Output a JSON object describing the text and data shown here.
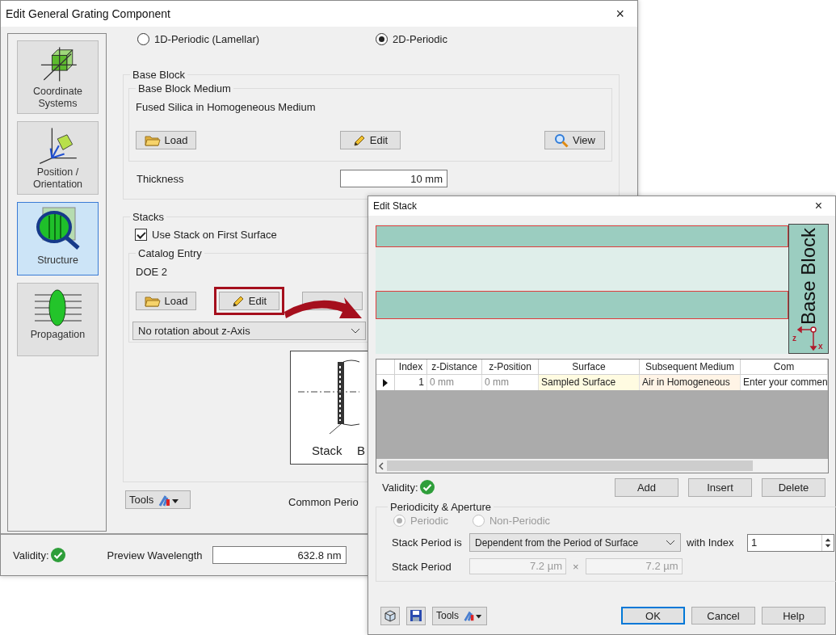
{
  "main_window": {
    "title": "Edit General Grating Component",
    "close": "×",
    "sidebar": [
      {
        "label": "Coordinate Systems",
        "kind": "coordinates",
        "selected": false
      },
      {
        "label": "Position / Orientation",
        "kind": "position",
        "selected": false
      },
      {
        "label": "Structure",
        "kind": "structure",
        "selected": true
      },
      {
        "label": "Propagation",
        "kind": "propagation",
        "selected": false
      }
    ],
    "periodicity": [
      {
        "label": "1D-Periodic (Lamellar)",
        "selected": false
      },
      {
        "label": "2D-Periodic",
        "selected": true
      }
    ],
    "base_block": {
      "title": "Base Block",
      "medium_title": "Base Block Medium",
      "medium": "Fused Silica in Homogeneous Medium",
      "buttons": [
        {
          "label": "Load",
          "kind": "load"
        },
        {
          "label": "Edit",
          "kind": "edit"
        },
        {
          "label": "View",
          "kind": "view"
        }
      ],
      "thickness_label": "Thickness",
      "thickness": "10 mm"
    },
    "stacks": {
      "title": "Stacks",
      "use_stack": {
        "label": "Use Stack on First Surface",
        "checked": true
      },
      "catalog_title": "Catalog Entry",
      "catalog": "DOE 2",
      "buttons": [
        {
          "label": "Load",
          "kind": "load",
          "highlighted": false
        },
        {
          "label": "Edit",
          "kind": "edit",
          "highlighted": true
        },
        {
          "kind": "covered",
          "highlighted": false
        }
      ],
      "rotation": "No rotation about z-Axis"
    },
    "diagram_labels": [
      "Stack",
      "B"
    ],
    "tools": "Tools",
    "common_period": "Common Perio",
    "footer": {
      "validity": "Validity:",
      "valid": true,
      "wavelength_label": "Preview Wavelength",
      "wavelength": "632.8 nm"
    }
  },
  "stack_window": {
    "title": "Edit Stack",
    "close": "×",
    "base_block_label": "Base Block",
    "axes": [
      "z",
      "x"
    ],
    "table": {
      "columns": [
        "Index",
        "z-Distance",
        "z-Position",
        "Surface",
        "Subsequent Medium",
        "Com"
      ],
      "rows": [
        {
          "current": true,
          "cells": [
            "1",
            "0 mm",
            "0 mm",
            "Sampled Surface",
            "Air in Homogeneous",
            "Enter your commen"
          ]
        }
      ]
    },
    "validity": "Validity:",
    "valid": true,
    "buttons": [
      "Add",
      "Insert",
      "Delete"
    ],
    "group": {
      "title": "Periodicity & Aperture",
      "radios": [
        {
          "label": "Periodic",
          "selected": true,
          "disabled": true
        },
        {
          "label": "Non-Periodic",
          "selected": false,
          "disabled": true
        }
      ],
      "period_is_label": "Stack Period is",
      "period_is": "Dependent from the Period of Surface",
      "with_index_label": "with Index",
      "index": "1",
      "period_label": "Stack Period",
      "period_x": "7.2 µm",
      "times": "×",
      "period_y": "7.2 µm"
    },
    "tools": "Tools",
    "actions": [
      {
        "label": "OK",
        "default": true
      },
      {
        "label": "Cancel",
        "default": false
      },
      {
        "label": "Help",
        "default": false
      }
    ]
  }
}
